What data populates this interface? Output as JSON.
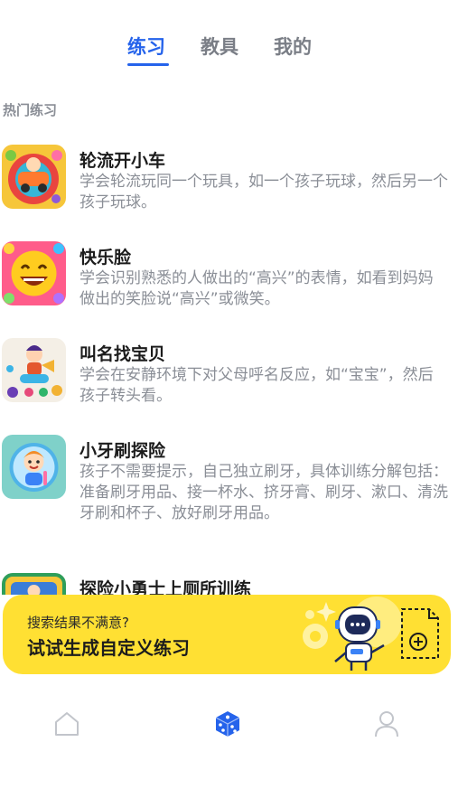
{
  "tabs": [
    {
      "label": "练习",
      "active": true
    },
    {
      "label": "教具",
      "active": false
    },
    {
      "label": "我的",
      "active": false
    }
  ],
  "section_title": "热门练习",
  "exercises": [
    {
      "title": "轮流开小车",
      "desc": "学会轮流玩同一个玩具，如一个孩子玩球，然后另一个孩子玩球。"
    },
    {
      "title": "快乐脸",
      "desc": "学会识别熟悉的人做出的“高兴”的表情，如看到妈妈做出的笑脸说“高兴”或微笑。"
    },
    {
      "title": "叫名找宝贝",
      "desc": "学会在安静环境下对父母呼名反应，如“宝宝”，然后孩子转头看。"
    },
    {
      "title": "小牙刷探险",
      "desc": "孩子不需要提示，自己独立刷牙，具体训练分解包括：准备刷牙用品、接一杯水、挤牙膏、刷牙、漱口、清洗牙刷和杯子、放好刷牙用品。"
    },
    {
      "title": "探险小勇士上厕所训练",
      "desc": ""
    }
  ],
  "banner": {
    "subtitle": "搜索结果不满意?",
    "title": "试试生成自定义练习",
    "robot_icon": "robot-icon",
    "add_doc_icon": "add-document-icon"
  },
  "bottom_nav": [
    {
      "icon": "home-icon",
      "active": false
    },
    {
      "icon": "dice-icon",
      "active": true
    },
    {
      "icon": "profile-icon",
      "active": false
    }
  ],
  "colors": {
    "accent": "#2563eb",
    "banner": "#ffe033",
    "muted_text": "#8a8e96"
  }
}
